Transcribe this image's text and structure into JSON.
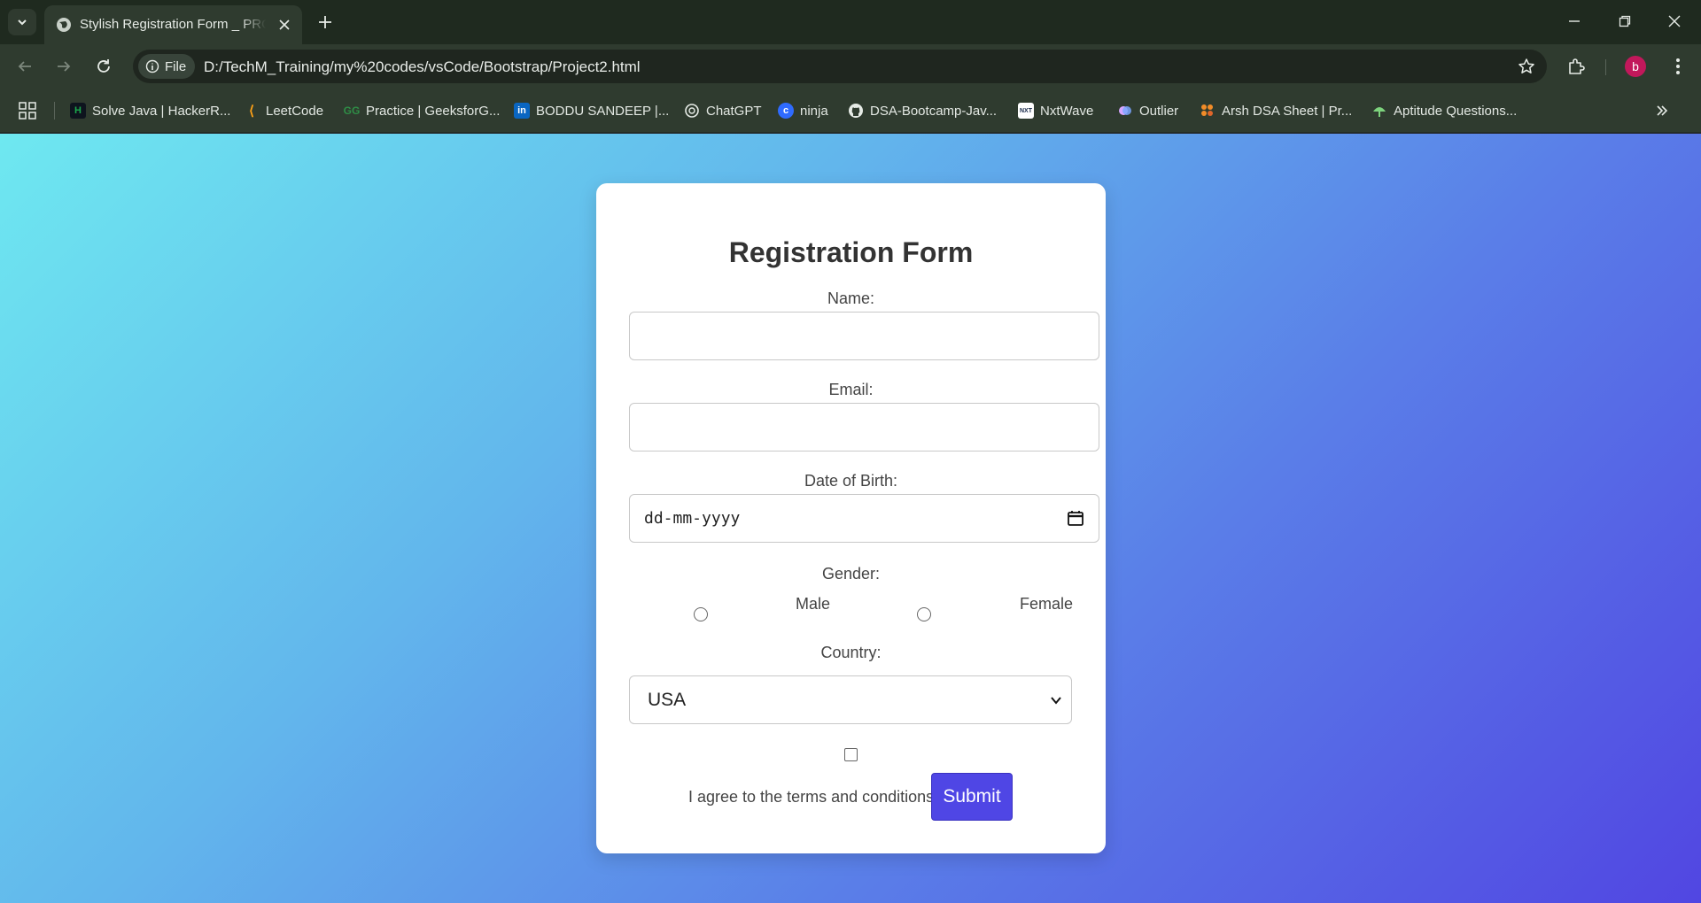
{
  "browser": {
    "tab": {
      "title": "Stylish Registration Form _ PRO"
    },
    "address_bar": {
      "site_chip": "File",
      "url": "D:/TechM_Training/my%20codes/vsCode/Bootstrap/Project2.html"
    },
    "profile_initial": "b",
    "bookmarks": [
      {
        "label": "Solve Java | HackerR...",
        "icon": "hackerrank-icon",
        "color": "#1ba94c"
      },
      {
        "label": "LeetCode",
        "icon": "leetcode-icon",
        "color": "#ffa116"
      },
      {
        "label": "Practice | GeeksforG...",
        "icon": "geeksforgeeks-icon",
        "color": "#2f8d46"
      },
      {
        "label": "BODDU SANDEEP |...",
        "icon": "linkedin-icon",
        "color": "#0a66c2"
      },
      {
        "label": "ChatGPT",
        "icon": "chatgpt-icon",
        "color": "#e6ebe6"
      },
      {
        "label": "ninja",
        "icon": "codingninjas-icon",
        "color": "#2f6bff"
      },
      {
        "label": "DSA-Bootcamp-Jav...",
        "icon": "github-icon",
        "color": "#e6ebe6"
      },
      {
        "label": "NxtWave",
        "icon": "nxtwave-icon",
        "color": "#ffffff"
      },
      {
        "label": "Outlier",
        "icon": "outlier-icon",
        "color": "#7aa6ff"
      },
      {
        "label": "Arsh DSA Sheet | Pr...",
        "icon": "arsh-icon",
        "color": "#f28c28"
      },
      {
        "label": "Aptitude Questions...",
        "icon": "aptitude-icon",
        "color": "#7dd37d"
      }
    ]
  },
  "form": {
    "title": "Registration Form",
    "name_label": "Name:",
    "name_value": "",
    "email_label": "Email:",
    "email_value": "",
    "dob_label": "Date of Birth:",
    "dob_placeholder": "dd-mm-yyyy",
    "gender_label": "Gender:",
    "gender_options": [
      "Male",
      "Female"
    ],
    "country_label": "Country:",
    "country_selected": "USA",
    "terms_text": "I agree to the terms and conditions",
    "submit_label": "Submit"
  },
  "colors": {
    "gradient_start": "#6ee8f0",
    "gradient_end": "#5146e2",
    "submit_bg": "#4f46e5"
  }
}
